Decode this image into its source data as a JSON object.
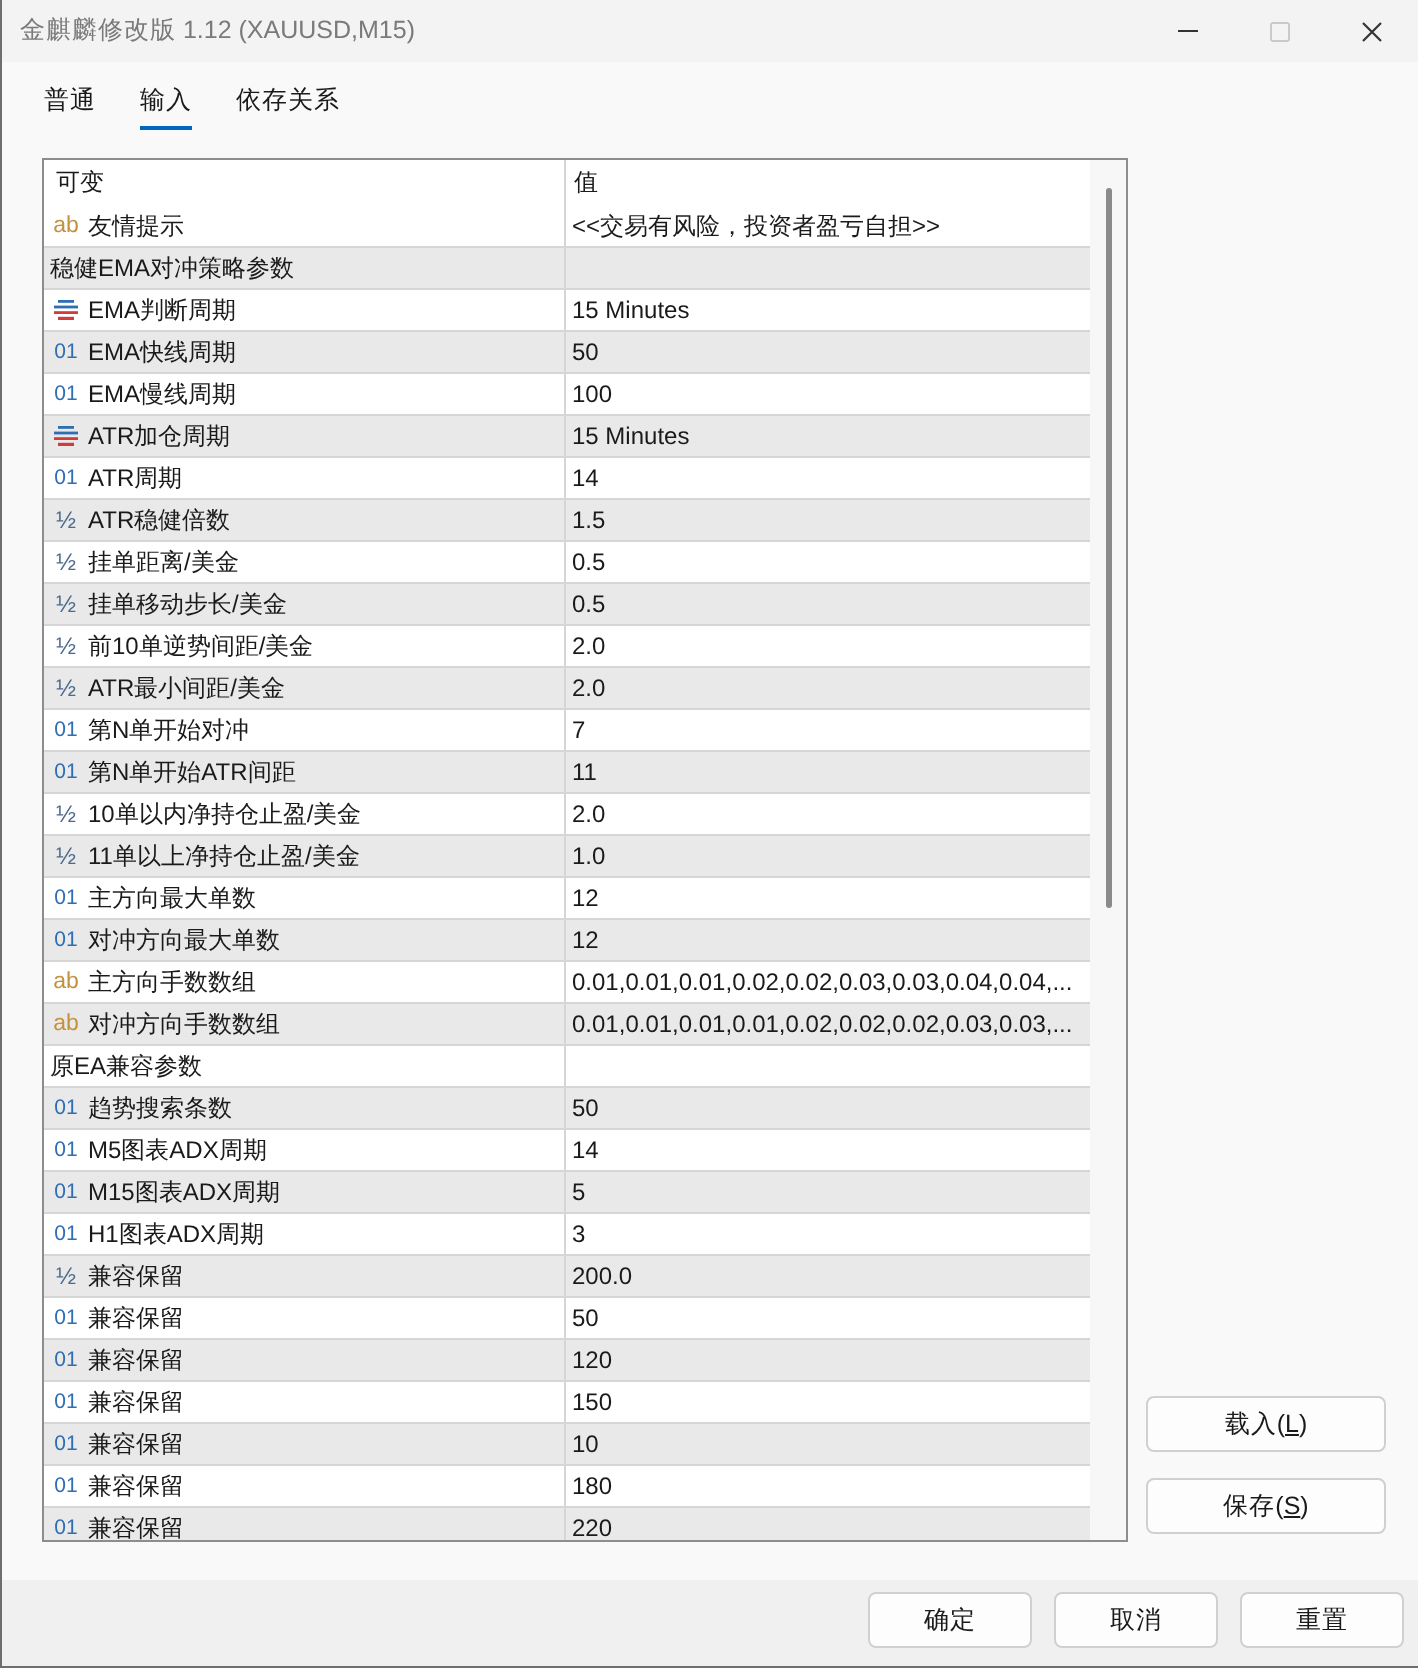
{
  "window": {
    "title": "金麒麟修改版 1.12 (XAUUSD,M15)",
    "controls": [
      {
        "kind": "minimize",
        "disabled": false
      },
      {
        "kind": "maximize",
        "disabled": true
      },
      {
        "kind": "close",
        "disabled": false
      }
    ]
  },
  "tabs": [
    {
      "label": "普通",
      "selected": false
    },
    {
      "label": "输入",
      "selected": true
    },
    {
      "label": "依存关系",
      "selected": false
    }
  ],
  "table": {
    "columns": [
      "可变",
      "值"
    ],
    "rows": [
      {
        "kind": "string",
        "icon": "ab",
        "name": "友情提示",
        "value": "<<交易有风险，投资者盈亏自担>>"
      },
      {
        "kind": "group",
        "name": "稳健EMA对冲策略参数"
      },
      {
        "kind": "enum",
        "name": "EMA判断周期",
        "value": "15 Minutes"
      },
      {
        "kind": "int",
        "icon": "01",
        "name": "EMA快线周期",
        "value": "50"
      },
      {
        "kind": "int",
        "icon": "01",
        "name": "EMA慢线周期",
        "value": "100"
      },
      {
        "kind": "enum",
        "name": "ATR加仓周期",
        "value": "15 Minutes"
      },
      {
        "kind": "int",
        "icon": "01",
        "name": "ATR周期",
        "value": "14"
      },
      {
        "kind": "double",
        "icon": "½",
        "name": "ATR稳健倍数",
        "value": "1.5"
      },
      {
        "kind": "double",
        "icon": "½",
        "name": "挂单距离/美金",
        "value": "0.5"
      },
      {
        "kind": "double",
        "icon": "½",
        "name": "挂单移动步长/美金",
        "value": "0.5"
      },
      {
        "kind": "double",
        "icon": "½",
        "name": "前10单逆势间距/美金",
        "value": "2.0"
      },
      {
        "kind": "double",
        "icon": "½",
        "name": "ATR最小间距/美金",
        "value": "2.0"
      },
      {
        "kind": "int",
        "icon": "01",
        "name": "第N单开始对冲",
        "value": "7"
      },
      {
        "kind": "int",
        "icon": "01",
        "name": "第N单开始ATR间距",
        "value": "11"
      },
      {
        "kind": "double",
        "icon": "½",
        "name": "10单以内净持仓止盈/美金",
        "value": "2.0"
      },
      {
        "kind": "double",
        "icon": "½",
        "name": "11单以上净持仓止盈/美金",
        "value": "1.0"
      },
      {
        "kind": "int",
        "icon": "01",
        "name": "主方向最大单数",
        "value": "12"
      },
      {
        "kind": "int",
        "icon": "01",
        "name": "对冲方向最大单数",
        "value": "12"
      },
      {
        "kind": "string",
        "icon": "ab",
        "name": "主方向手数数组",
        "value": "0.01,0.01,0.01,0.02,0.02,0.03,0.03,0.04,0.04,..."
      },
      {
        "kind": "string",
        "icon": "ab",
        "name": "对冲方向手数数组",
        "value": "0.01,0.01,0.01,0.01,0.02,0.02,0.02,0.03,0.03,..."
      },
      {
        "kind": "group",
        "name": "原EA兼容参数"
      },
      {
        "kind": "int",
        "icon": "01",
        "name": "趋势搜索条数",
        "value": "50"
      },
      {
        "kind": "int",
        "icon": "01",
        "name": "M5图表ADX周期",
        "value": "14"
      },
      {
        "kind": "int",
        "icon": "01",
        "name": "M15图表ADX周期",
        "value": "5"
      },
      {
        "kind": "int",
        "icon": "01",
        "name": "H1图表ADX周期",
        "value": "3"
      },
      {
        "kind": "double",
        "icon": "½",
        "name": "兼容保留",
        "value": "200.0"
      },
      {
        "kind": "int",
        "icon": "01",
        "name": "兼容保留",
        "value": "50"
      },
      {
        "kind": "int",
        "icon": "01",
        "name": "兼容保留",
        "value": "120"
      },
      {
        "kind": "int",
        "icon": "01",
        "name": "兼容保留",
        "value": "150"
      },
      {
        "kind": "int",
        "icon": "01",
        "name": "兼容保留",
        "value": "10"
      },
      {
        "kind": "int",
        "icon": "01",
        "name": "兼容保留",
        "value": "180"
      },
      {
        "kind": "int",
        "icon": "01",
        "name": "兼容保留",
        "value": "220"
      }
    ]
  },
  "side_buttons": [
    {
      "label": "载入(",
      "mnemonic": "L",
      "label_end": ")"
    },
    {
      "label": "保存(",
      "mnemonic": "S",
      "label_end": ")"
    }
  ],
  "footer_buttons": [
    "确定",
    "取消",
    "重置"
  ]
}
